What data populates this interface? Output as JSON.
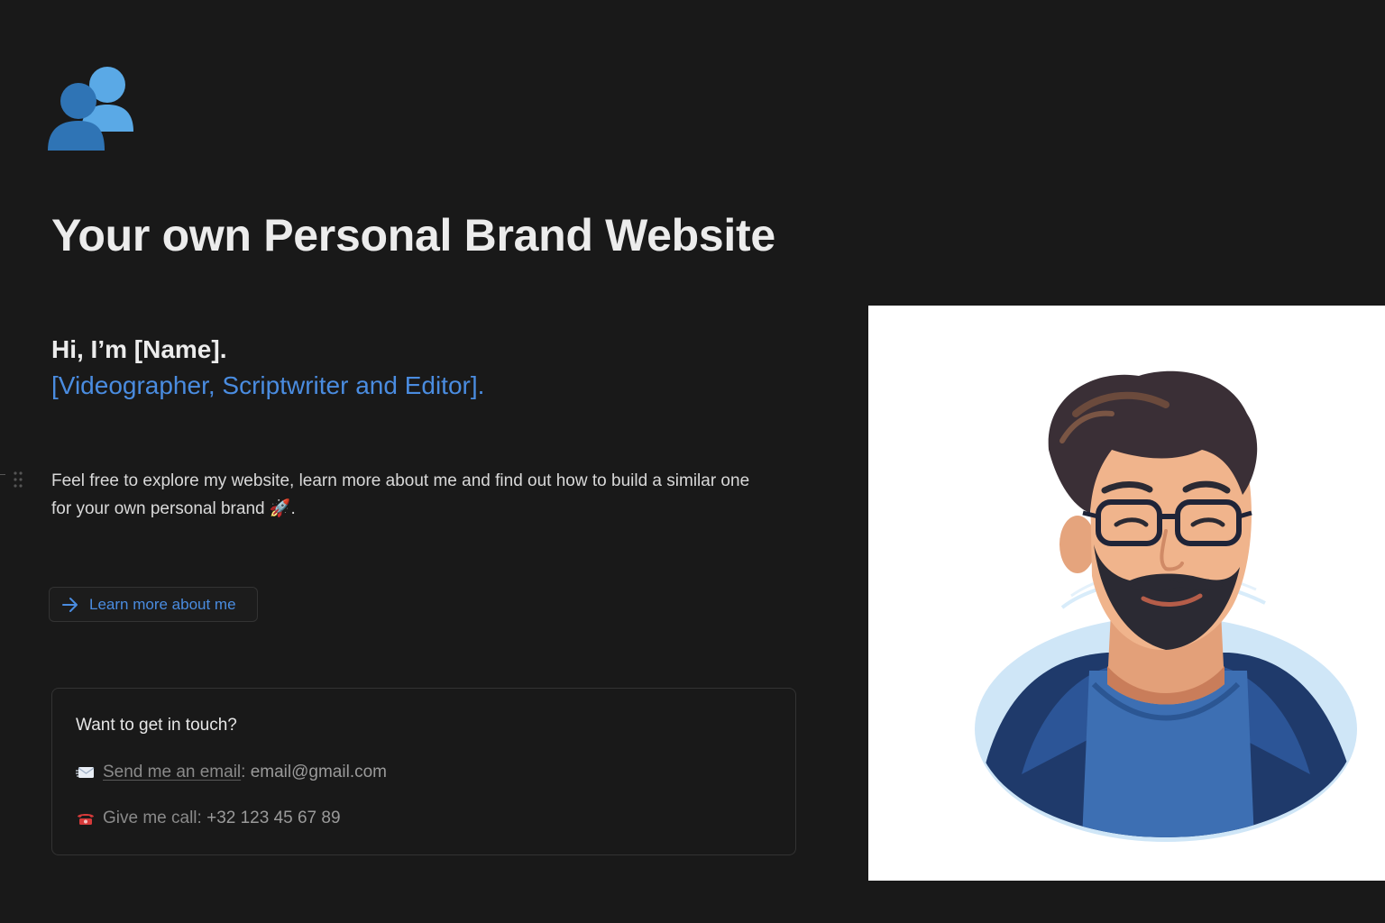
{
  "page": {
    "icon": "busts-in-silhouette-icon",
    "title": "Your own Personal Brand Website"
  },
  "greeting": {
    "line1": "Hi, I’m [Name].",
    "line2": "[Videographer, Scriptwriter and Editor]."
  },
  "intro": {
    "text": "Feel free to explore my website, learn more about me and find out how to build a similar one for your own personal brand",
    "emoji": "🚀",
    "end": "."
  },
  "cta": {
    "icon": "arrow-right-icon",
    "label": "Learn more about me"
  },
  "contact": {
    "heading": "Want to get in touch?",
    "email": {
      "icon": "envelope-icon",
      "link_text": "Send me an email",
      "separator": ":",
      "value": "email@gmail.com"
    },
    "phone": {
      "icon": "telephone-icon",
      "label": "Give me call:",
      "value": "+32 123 45 67 89"
    }
  },
  "portrait": {
    "icon": "avatar-illustration",
    "alt": ""
  },
  "colors": {
    "background": "#191919",
    "accent": "#4a8ce0",
    "text": "#ececec",
    "muted": "#8a8a8a"
  }
}
